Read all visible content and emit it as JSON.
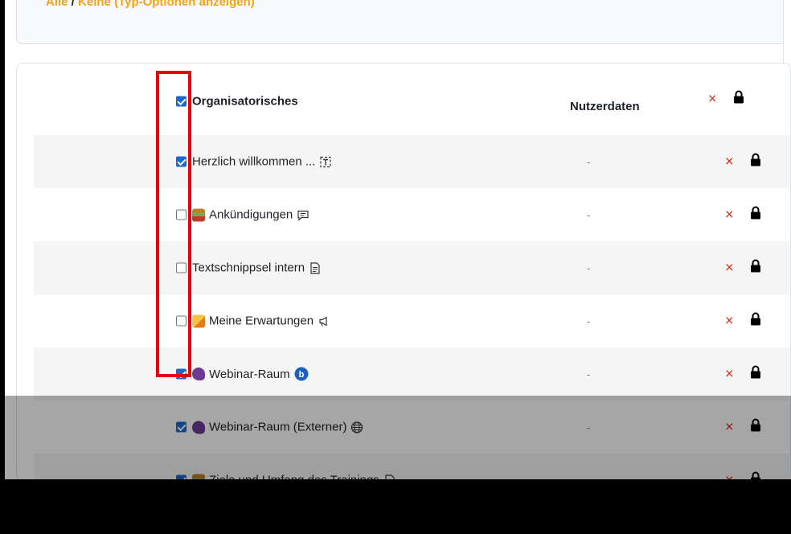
{
  "top_links": {
    "all": "Alle",
    "separator": " / ",
    "none": "Keine",
    "type_options": "(Typ-Optionen anzeigen)"
  },
  "header": {
    "section_label": "Organisatorisches",
    "column_label": "Nutzerdaten",
    "checked": true
  },
  "rows": [
    {
      "label": "Herzlich willkommen ...",
      "checked": true,
      "icon": "text-frame-icon",
      "emoji": "",
      "userdata": "-"
    },
    {
      "label": "Ankündigungen",
      "checked": false,
      "icon": "forum-icon",
      "emoji": "presentation-emoji",
      "userdata": "-"
    },
    {
      "label": "Textschnippsel intern",
      "checked": false,
      "icon": "page-icon",
      "emoji": "",
      "userdata": "-"
    },
    {
      "label": "Meine Erwartungen",
      "checked": false,
      "icon": "feedback-icon",
      "emoji": "writing-hand-emoji",
      "userdata": "-"
    },
    {
      "label": "Webinar-Raum",
      "checked": true,
      "icon": "bigbluebutton-icon",
      "emoji": "speaking-head-emoji",
      "userdata": "-"
    },
    {
      "label": "Webinar-Raum (Externer)",
      "checked": true,
      "icon": "globe-icon",
      "emoji": "speaking-head-emoji",
      "userdata": "-"
    },
    {
      "label": "Ziele und Umfang des Trainings",
      "checked": true,
      "icon": "page-icon",
      "emoji": "presentation-emoji",
      "userdata": ""
    }
  ],
  "actions": {
    "delete_icon": "×",
    "lock_icon": "lock-icon"
  },
  "colors": {
    "accent": "#f7a21b",
    "checkbox": "#1967d2",
    "delete": "#ca3120",
    "highlight": "#e4010b"
  }
}
